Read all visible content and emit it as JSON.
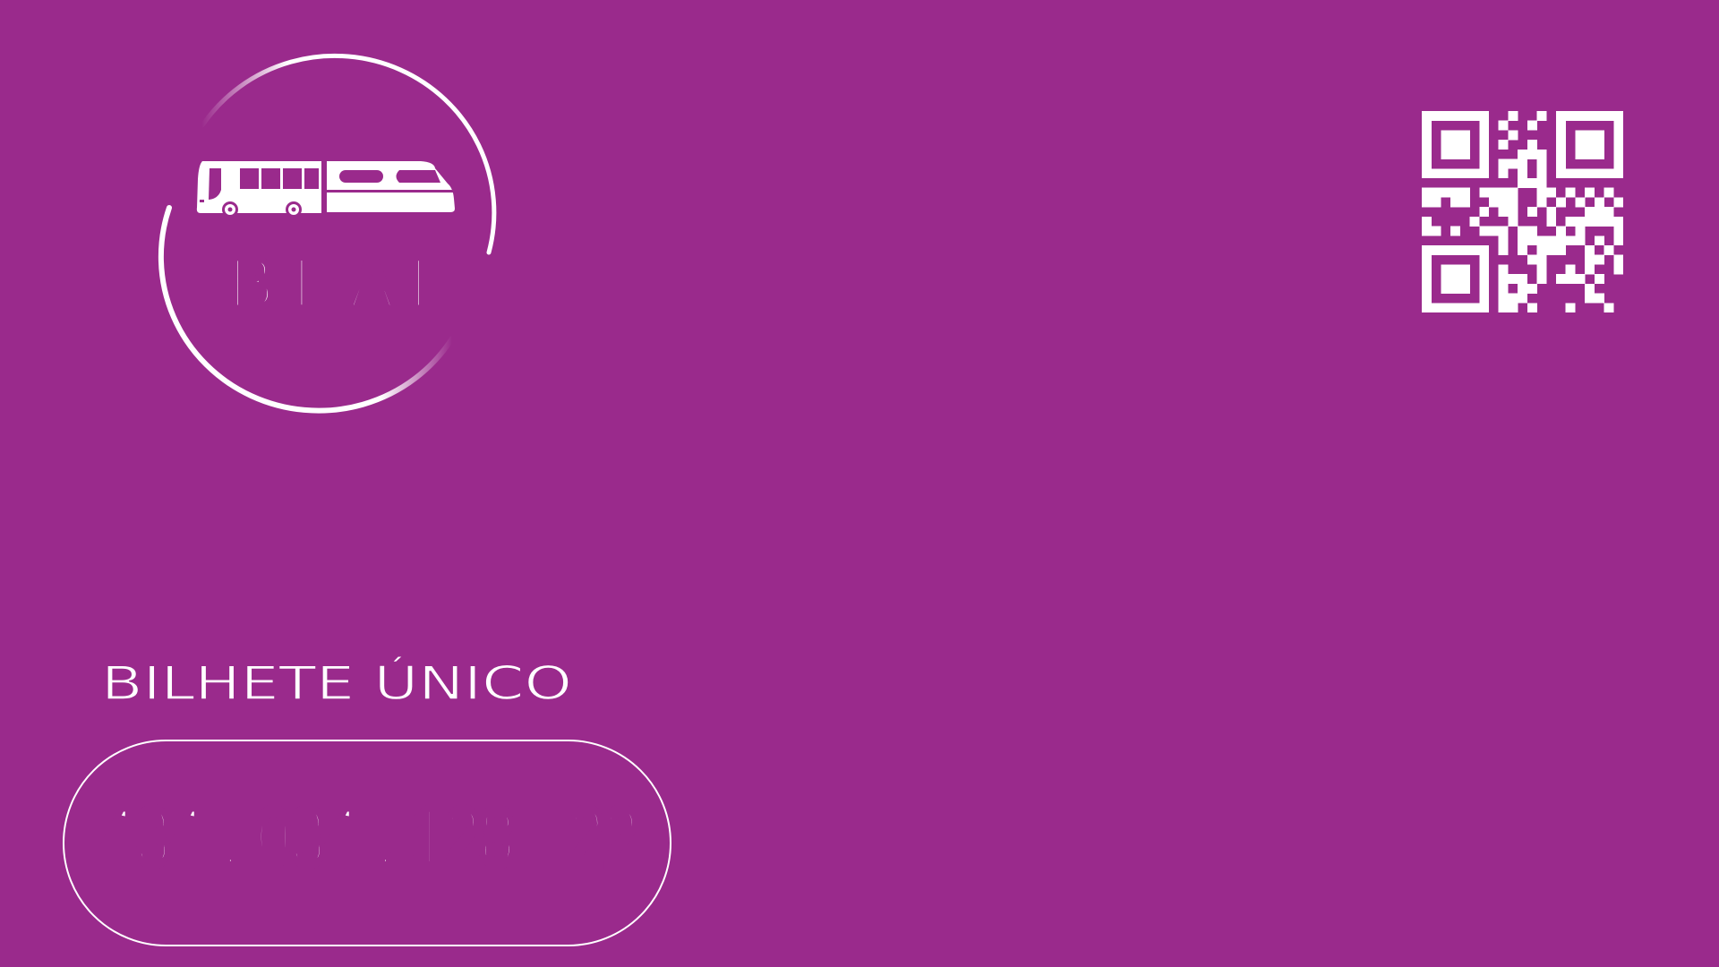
{
  "card": {
    "background_color": "#9a2a8c",
    "foreground_color": "#ffffff",
    "logo": {
      "text": "B F A I",
      "icons": [
        "bus-icon",
        "train-icon"
      ]
    },
    "qr_code": {
      "icon": "qr-code"
    },
    "title": "BILHETE ÚNICO",
    "card_number": "434 . 034 . 128 - 22"
  }
}
